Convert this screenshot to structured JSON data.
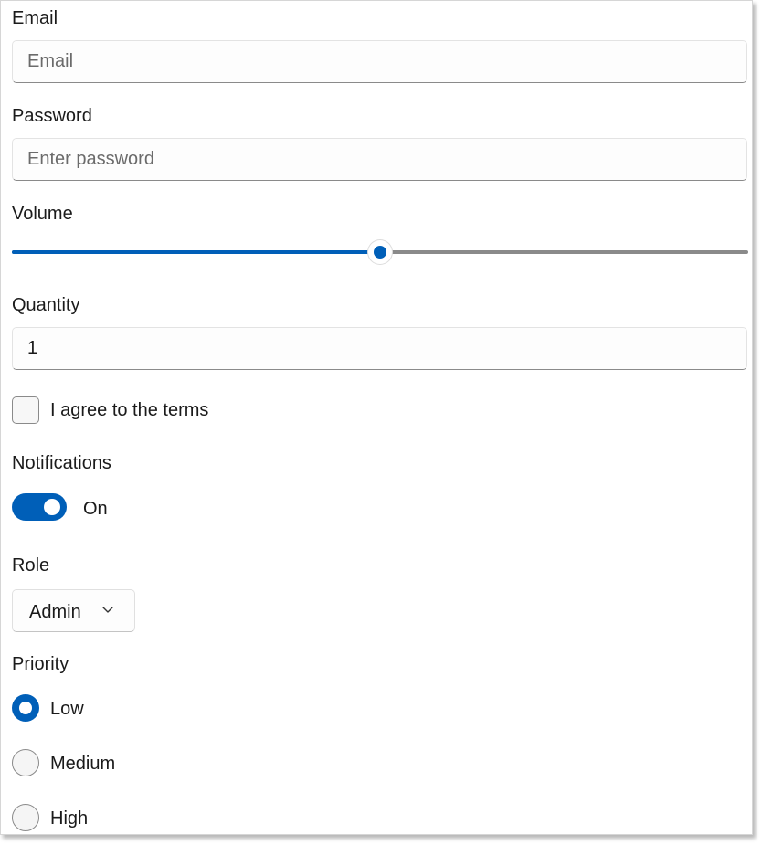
{
  "form": {
    "email": {
      "label": "Email",
      "placeholder": "Email",
      "value": ""
    },
    "password": {
      "label": "Password",
      "placeholder": "Enter password",
      "value": ""
    },
    "volume": {
      "label": "Volume",
      "value_fraction": 0.5
    },
    "quantity": {
      "label": "Quantity",
      "value": "1"
    },
    "terms": {
      "label": "I agree to the terms",
      "checked": false
    },
    "notifications": {
      "label": "Notifications",
      "state_label": "On",
      "on": true
    },
    "role": {
      "label": "Role",
      "selected": "Admin"
    },
    "priority": {
      "label": "Priority",
      "options": [
        {
          "label": "Low",
          "checked": true
        },
        {
          "label": "Medium",
          "checked": false
        },
        {
          "label": "High",
          "checked": false
        }
      ]
    }
  },
  "colors": {
    "accent": "#005fb8",
    "track": "#8a8a8a",
    "border": "#e3e3e3"
  },
  "icons": {
    "dropdown": "chevron-down-icon"
  }
}
